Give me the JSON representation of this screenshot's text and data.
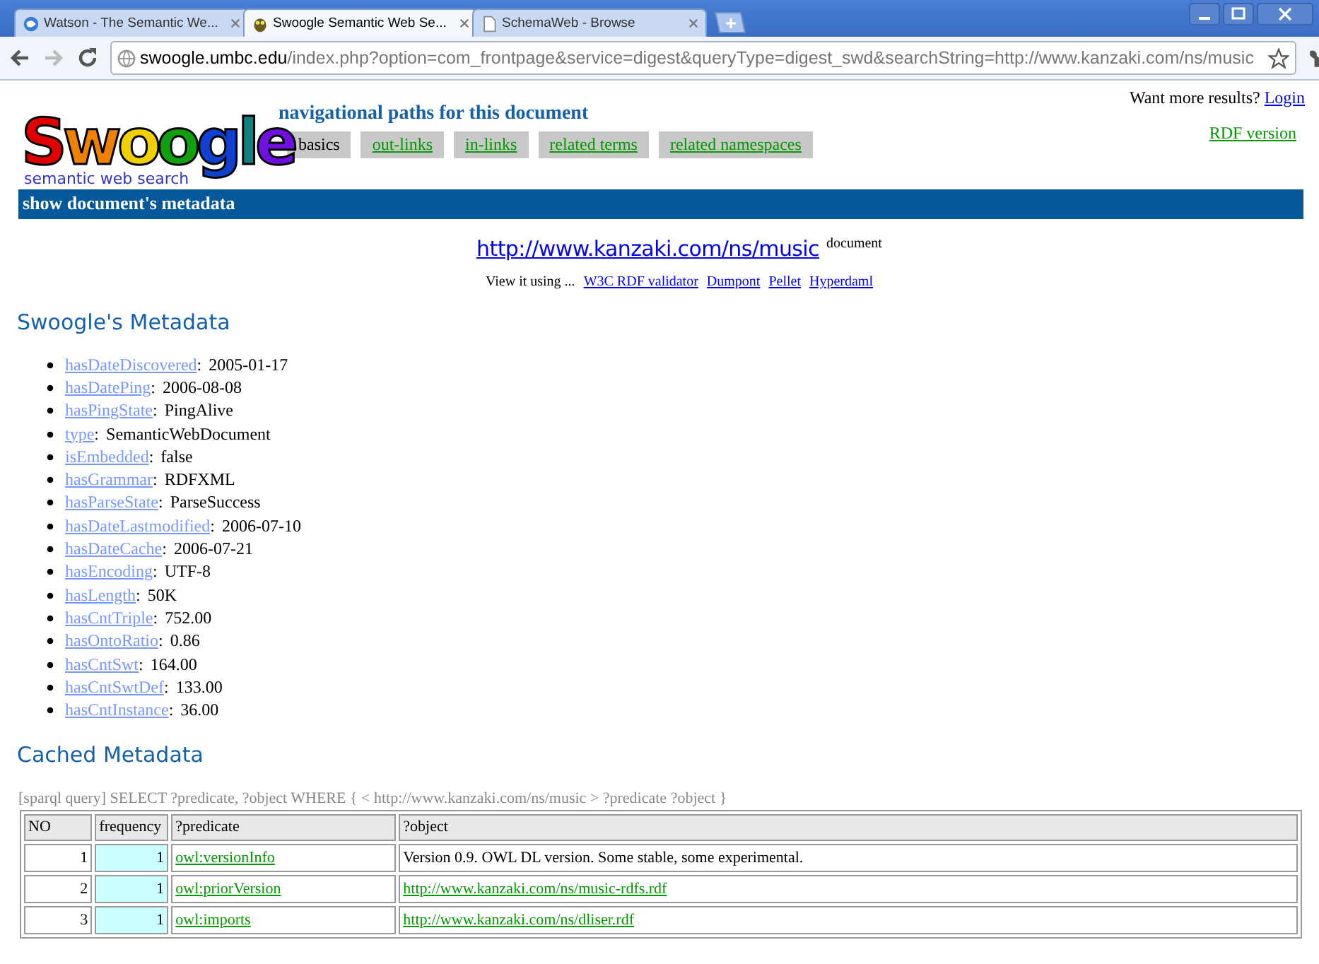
{
  "browser": {
    "tabs": [
      {
        "title": "Watson - The Semantic We...",
        "selected": false
      },
      {
        "title": "Swoogle Semantic Web Se...",
        "selected": true
      },
      {
        "title": "SchemaWeb - Browse",
        "selected": false
      }
    ],
    "url_host": "swoogle.umbc.edu",
    "url_path": "/index.php?option=com_frontpage&service=digest&queryType=digest_swd&searchString=http://www.kanzaki.com/ns/music"
  },
  "header": {
    "login_prompt": "Want more results?",
    "login_link": "Login",
    "logo": "Swoogle",
    "logo_tagline": "semantic web search",
    "nav_title": "navigational paths for this document",
    "nav_tabs": [
      {
        "label": "basics",
        "selected": true
      },
      {
        "label": "out-links",
        "selected": false
      },
      {
        "label": "in-links",
        "selected": false
      },
      {
        "label": "related terms",
        "selected": false
      },
      {
        "label": "related namespaces",
        "selected": false
      }
    ],
    "rdf_link": "RDF version",
    "banner": "show document's metadata"
  },
  "document": {
    "url": "http://www.kanzaki.com/ns/music",
    "label": "document",
    "view_prefix": "View it using ...",
    "viewers": [
      "W3C RDF validator",
      "Dumpont",
      "Pellet",
      "Hyperdaml"
    ]
  },
  "metadata": {
    "heading": "Swoogle's Metadata",
    "items": [
      {
        "key": "hasDateDiscovered",
        "sep": ":",
        "value": "2005-01-17"
      },
      {
        "key": "hasDatePing",
        "sep": ":",
        "value": "2006-08-08"
      },
      {
        "key": "hasPingState",
        "sep": ":",
        "value": "PingAlive"
      },
      {
        "key": "type",
        "sep": ":",
        "value": "SemanticWebDocument"
      },
      {
        "key": "isEmbedded",
        "sep": ":",
        "value": "false"
      },
      {
        "key": "hasGrammar",
        "sep": ":",
        "value": "RDFXML"
      },
      {
        "key": "hasParseState",
        "sep": ":",
        "value": "ParseSuccess"
      },
      {
        "key": "hasDateLastmodified",
        "sep": ":",
        "value": "2006-07-10"
      },
      {
        "key": "hasDateCache",
        "sep": ":",
        "value": "2006-07-21"
      },
      {
        "key": "hasEncoding",
        "sep": ":",
        "value": "UTF-8"
      },
      {
        "key": "hasLength",
        "sep": ":",
        "value": "50K"
      },
      {
        "key": "hasCntTriple",
        "sep": ":",
        "value": "752.00"
      },
      {
        "key": "hasOntoRatio",
        "sep": ":",
        "value": "0.86"
      },
      {
        "key": "hasCntSwt",
        "sep": ":",
        "value": "164.00"
      },
      {
        "key": "hasCntSwtDef",
        "sep": ":",
        "value": "133.00"
      },
      {
        "key": "hasCntInstance",
        "sep": ":",
        "value": "36.00"
      }
    ]
  },
  "cached": {
    "heading": "Cached Metadata",
    "query": "[sparql query] SELECT ?predicate, ?object WHERE { < http://www.kanzaki.com/ns/music > ?predicate ?object }",
    "columns": [
      "NO",
      "frequency",
      "?predicate",
      "?object"
    ],
    "rows": [
      {
        "no": "1",
        "frequency": "1",
        "predicate": "owl:versionInfo",
        "object": "Version 0.9. OWL DL version. Some stable, some experimental.",
        "kind": "text"
      },
      {
        "no": "2",
        "frequency": "1",
        "predicate": "owl:priorVersion",
        "object": "http://www.kanzaki.com/ns/music-rdfs.rdf",
        "kind": "link"
      },
      {
        "no": "3",
        "frequency": "1",
        "predicate": "owl:imports",
        "object": "http://www.kanzaki.com/ns/dliser.rdf",
        "kind": "link"
      }
    ]
  }
}
